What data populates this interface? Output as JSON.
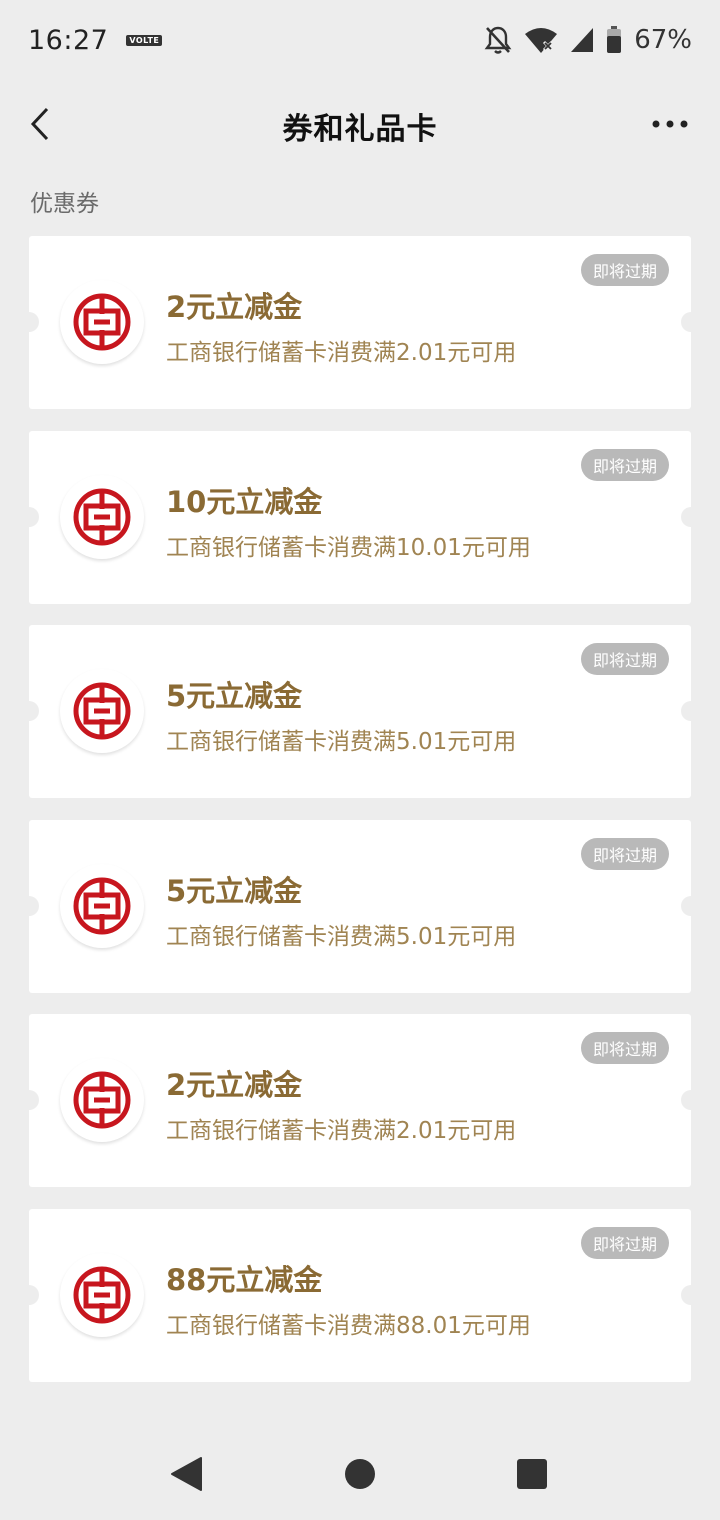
{
  "status_bar": {
    "time": "16:27",
    "volte": "VOLTE",
    "battery": "67%"
  },
  "nav": {
    "title": "券和礼品卡"
  },
  "section_label": "优惠券",
  "coupons": [
    {
      "title": "2元立减金",
      "desc": "工商银行储蓄卡消费满2.01元可用",
      "badge": "即将过期"
    },
    {
      "title": "10元立减金",
      "desc": "工商银行储蓄卡消费满10.01元可用",
      "badge": "即将过期"
    },
    {
      "title": "5元立减金",
      "desc": "工商银行储蓄卡消费满5.01元可用",
      "badge": "即将过期"
    },
    {
      "title": "5元立减金",
      "desc": "工商银行储蓄卡消费满5.01元可用",
      "badge": "即将过期"
    },
    {
      "title": "2元立减金",
      "desc": "工商银行储蓄卡消费满2.01元可用",
      "badge": "即将过期"
    },
    {
      "title": "88元立减金",
      "desc": "工商银行储蓄卡消费满88.01元可用",
      "badge": "即将过期"
    }
  ],
  "colors": {
    "background": "#ededed",
    "coupon_title": "#8a6a34",
    "coupon_desc": "#a08452",
    "badge_bg": "#b9b9b9",
    "icbc_red": "#c7161e"
  },
  "icons": {
    "back": "chevron-left-icon",
    "more": "more-dots-icon",
    "bank_logo": "icbc-logo-icon",
    "mute": "bell-off-icon",
    "wifi": "wifi-icon",
    "signal": "signal-icon",
    "battery": "battery-icon"
  }
}
